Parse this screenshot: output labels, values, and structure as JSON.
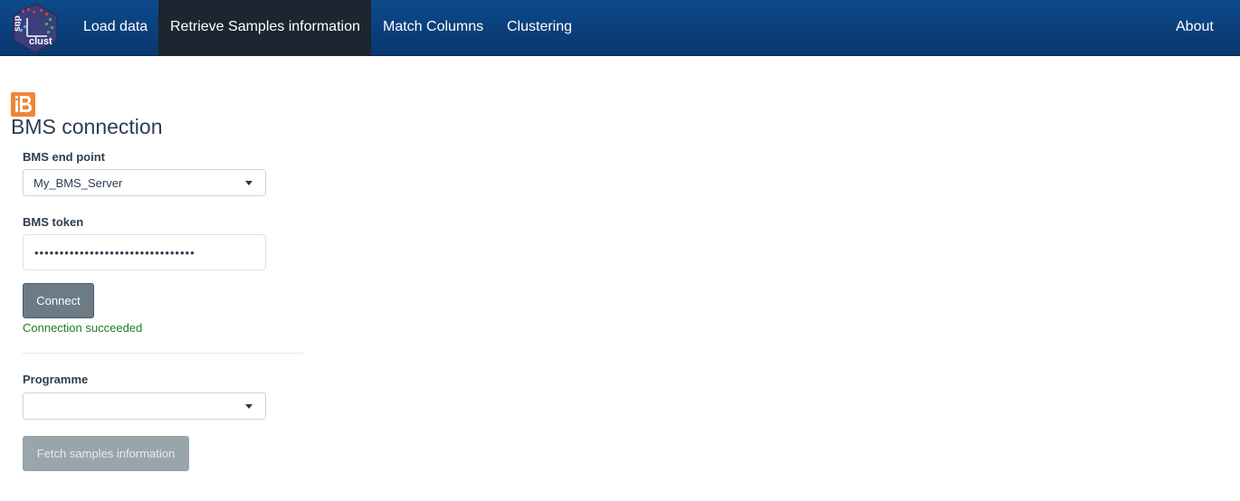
{
  "navbar": {
    "logo_text": "snp clust",
    "items": [
      {
        "label": "Load data"
      },
      {
        "label": "Retrieve Samples information"
      },
      {
        "label": "Match Columns"
      },
      {
        "label": "Clustering"
      }
    ],
    "active_item": "Retrieve Samples information",
    "right_item": {
      "label": "About"
    }
  },
  "main": {
    "logo_letter": "B",
    "title": "BMS connection",
    "endpoint": {
      "label": "BMS end point",
      "value": "My_BMS_Server"
    },
    "token": {
      "label": "BMS token",
      "value": "••••••••••••••••••••••••••••••••"
    },
    "connect_button": "Connect",
    "status": "Connection succeeded",
    "programme": {
      "label": "Programme",
      "value": ""
    },
    "fetch_button": "Fetch samples information"
  },
  "colors": {
    "navbar": "#0a3f7a",
    "active_tab": "#1c2530",
    "status_success": "#1e7d1e",
    "brand_orange": "#ef8535"
  },
  "icons": {
    "app_logo": "snpclust-hex-logo",
    "bms_logo": "bms-logo",
    "dropdown": "caret-down-icon"
  }
}
